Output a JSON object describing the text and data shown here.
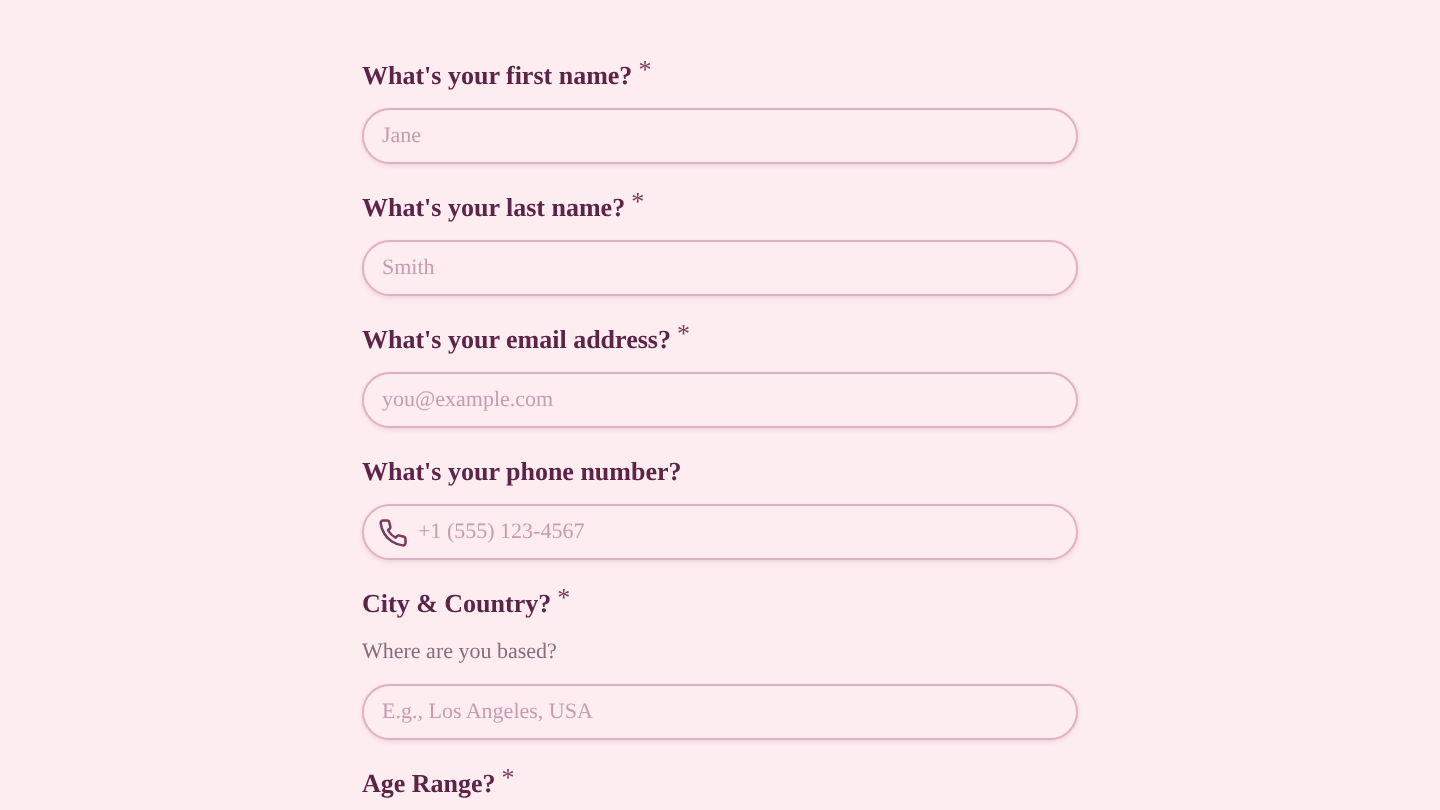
{
  "fields": [
    {
      "label": "What's your first name?",
      "asterisk": "*",
      "placeholder": "Jane"
    },
    {
      "label": "What's your last name?",
      "asterisk": "*",
      "placeholder": "Smith"
    },
    {
      "label": "What's your email address?",
      "asterisk": "*",
      "placeholder": "you@example.com"
    },
    {
      "label": "What's your phone number?",
      "placeholder": "+1 (555) 123-4567",
      "kind": "phone"
    },
    {
      "label": "City & Country?",
      "asterisk": "*",
      "hint": "Where are you based?",
      "placeholder": "E.g., Los Angeles, USA"
    },
    {
      "label": "Age Range?",
      "asterisk": "*"
    }
  ]
}
